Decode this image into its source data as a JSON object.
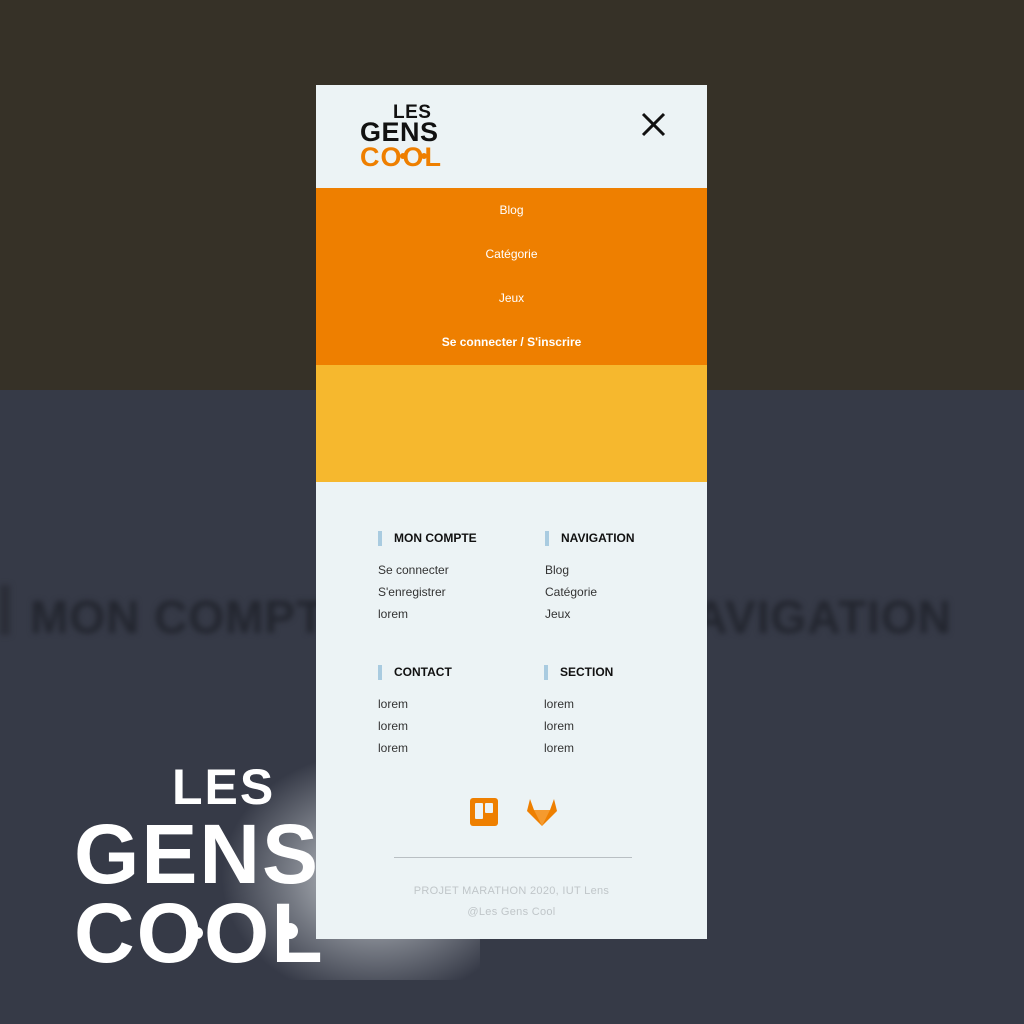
{
  "background": {
    "blurred_headings": [
      "MON COMPTE",
      "NAVIGATION"
    ]
  },
  "phone": {
    "logo": {
      "line1": "LES",
      "line2": "GENS",
      "line3": "COOL"
    },
    "close_icon": "close-icon",
    "menu": [
      {
        "label": "Blog"
      },
      {
        "label": "Catégorie"
      },
      {
        "label": "Jeux"
      },
      {
        "label": "Se connecter / S'inscrire"
      }
    ],
    "footer": {
      "mon_compte": {
        "title": "MON COMPTE",
        "links": [
          "Se connecter",
          "S'enregistrer",
          "lorem"
        ]
      },
      "navigation": {
        "title": "NAVIGATION",
        "links": [
          "Blog",
          "Catégorie",
          "Jeux"
        ]
      },
      "contact": {
        "title": "CONTACT",
        "links": [
          "lorem",
          "lorem",
          "lorem"
        ]
      },
      "section": {
        "title": "SECTION",
        "links": [
          "lorem",
          "lorem",
          "lorem"
        ]
      }
    },
    "social_icons": [
      "trello-icon",
      "gitlab-icon"
    ],
    "copyright_line1": "PROJET MARATHON 2020, IUT Lens",
    "copyright_line2": "@Les Gens Cool"
  },
  "big_logo": {
    "line1": "LES",
    "line2": "GENS",
    "line3": "COOL"
  },
  "colors": {
    "orange": "#ee7f00",
    "yellow": "#f6b82e",
    "light_bg": "#ecf3f5",
    "accent_bar": "#a9cbe0"
  }
}
